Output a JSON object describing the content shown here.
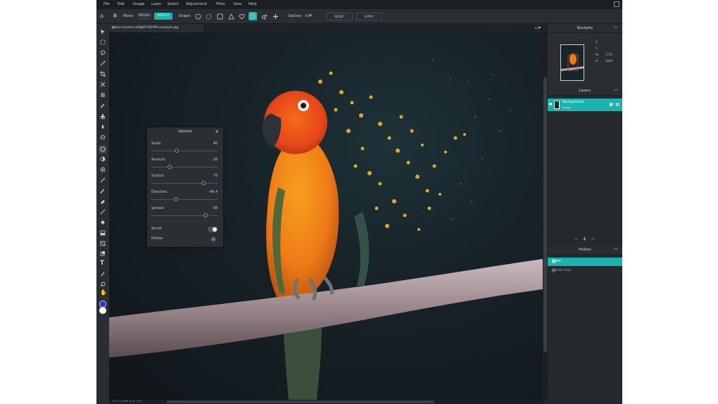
{
  "menu": [
    "File",
    "Edit",
    "Image",
    "Layer",
    "Select",
    "Adjustment",
    "Filter",
    "View",
    "Help"
  ],
  "optionbar": {
    "mode_label": "Mode:",
    "brush_label": "BRUSH",
    "effect_label": "EFFECT",
    "shape_label": "Shape:",
    "options_label": "Options",
    "reset_label": "RESET",
    "apply_label": "APPLY"
  },
  "tab": {
    "filename": "bexio-mueller-aeNgtFH4SYM-unsplash.jpg",
    "close": "×"
  },
  "options_dialog": {
    "title": "Options",
    "close": "✕",
    "sliders": [
      {
        "label": "Scale:",
        "value": "40",
        "fraction": 0.38
      },
      {
        "label": "Amount:",
        "value": "28",
        "fraction": 0.28
      },
      {
        "label": "Stretch:",
        "value": "79",
        "fraction": 0.79
      },
      {
        "label": "Direction:",
        "value": "-46.4",
        "fraction": 0.37
      },
      {
        "label": "Spread:",
        "value": "68",
        "fraction": 0.82
      }
    ],
    "shrink_label": "Shrink",
    "hollow_label": "Hollow"
  },
  "navigate": {
    "title": "Navigate",
    "x_label": "X:",
    "y_label": "Y:",
    "w_label": "W:",
    "w_value": "2712",
    "h_label": "H:",
    "h_value": "4068",
    "zoom_value": "17%",
    "zoom_minus": "-",
    "zoom_plus": "+"
  },
  "layers": {
    "title": "Layers",
    "items": [
      {
        "name": "Background",
        "sub": "Image"
      }
    ]
  },
  "history": {
    "title": "History",
    "items": [
      {
        "label": "Open"
      },
      {
        "label": "Anime step"
      }
    ]
  },
  "status": {
    "text": "2712 × 4068 px @ 17%"
  },
  "colors": {
    "accent": "#1ab3ae",
    "foreground": "#2233ee",
    "background": "#ffffff"
  }
}
